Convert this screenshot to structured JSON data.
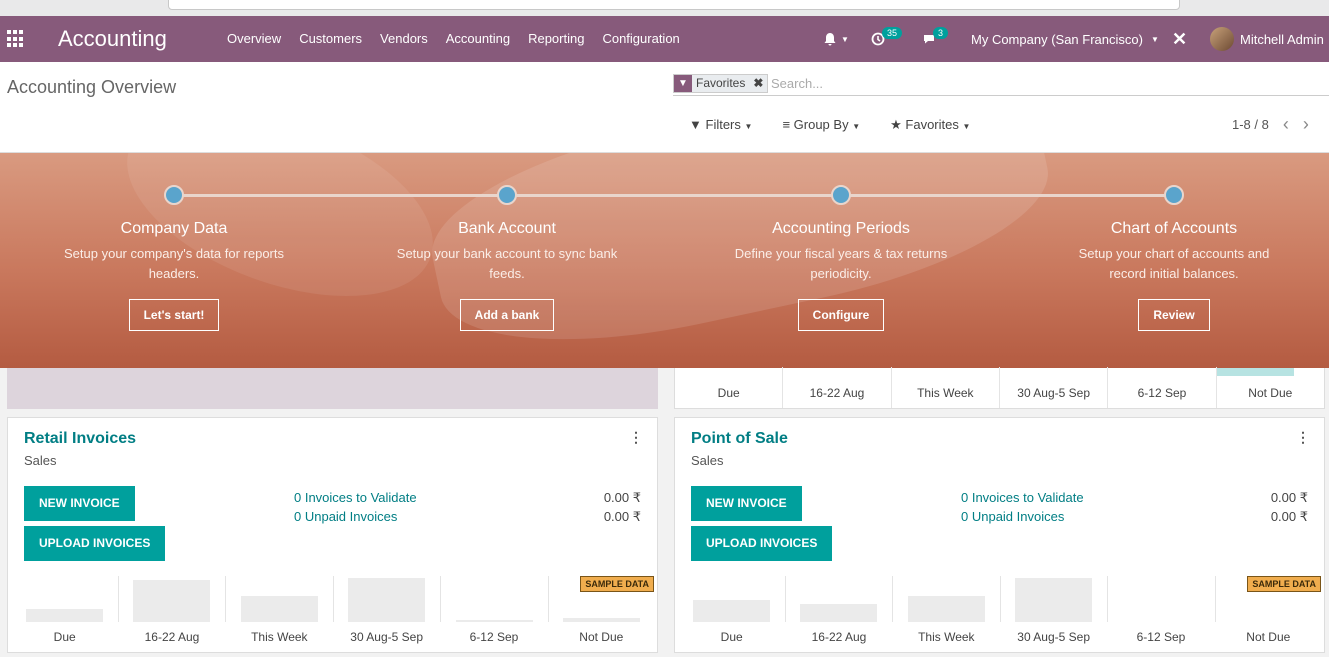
{
  "navbar": {
    "brand": "Accounting",
    "menu": [
      "Overview",
      "Customers",
      "Vendors",
      "Accounting",
      "Reporting",
      "Configuration"
    ],
    "activity_count": "35",
    "message_count": "3",
    "company": "My Company (San Francisco)",
    "user": "Mitchell Admin"
  },
  "control_panel": {
    "title": "Accounting Overview",
    "facet": "Favorites",
    "search_placeholder": "Search...",
    "filters": "Filters",
    "group_by": "Group By",
    "favorites": "Favorites",
    "pager": "1-8 / 8"
  },
  "onboarding": {
    "steps": [
      {
        "title": "Company Data",
        "desc": "Setup your company's data for reports headers.",
        "button": "Let's start!"
      },
      {
        "title": "Bank Account",
        "desc": "Setup your bank account to sync bank feeds.",
        "button": "Add a bank"
      },
      {
        "title": "Accounting Periods",
        "desc": "Define your fiscal years & tax returns periodicity.",
        "button": "Configure"
      },
      {
        "title": "Chart of Accounts",
        "desc": "Setup your chart of accounts and record initial balances.",
        "button": "Review"
      }
    ]
  },
  "axis_labels": [
    "Due",
    "16-22 Aug",
    "This Week",
    "30 Aug-5 Sep",
    "6-12 Sep",
    "Not Due"
  ],
  "journals": [
    {
      "title": "Retail Invoices",
      "type": "Sales",
      "new_button": "NEW INVOICE",
      "upload_button": "UPLOAD INVOICES",
      "link1": "0 Invoices to Validate",
      "link2": "0 Unpaid Invoices",
      "amount1": "0.00 ₹",
      "amount2": "0.00 ₹",
      "sample": "SAMPLE DATA",
      "bar_levels": [
        0.3,
        0.95,
        0.6,
        1.0,
        0.05,
        0.08
      ]
    },
    {
      "title": "Point of Sale",
      "type": "Sales",
      "new_button": "NEW INVOICE",
      "upload_button": "UPLOAD INVOICES",
      "link1": "0 Invoices to Validate",
      "link2": "0 Unpaid Invoices",
      "amount1": "0.00 ₹",
      "amount2": "0.00 ₹",
      "sample": "SAMPLE DATA",
      "bar_levels": [
        0.5,
        0.4,
        0.6,
        1.0,
        0.0,
        0.0
      ]
    }
  ],
  "colors": {
    "brand": "#875a7b",
    "accent": "#00a09d",
    "banner": "#c9785d"
  }
}
